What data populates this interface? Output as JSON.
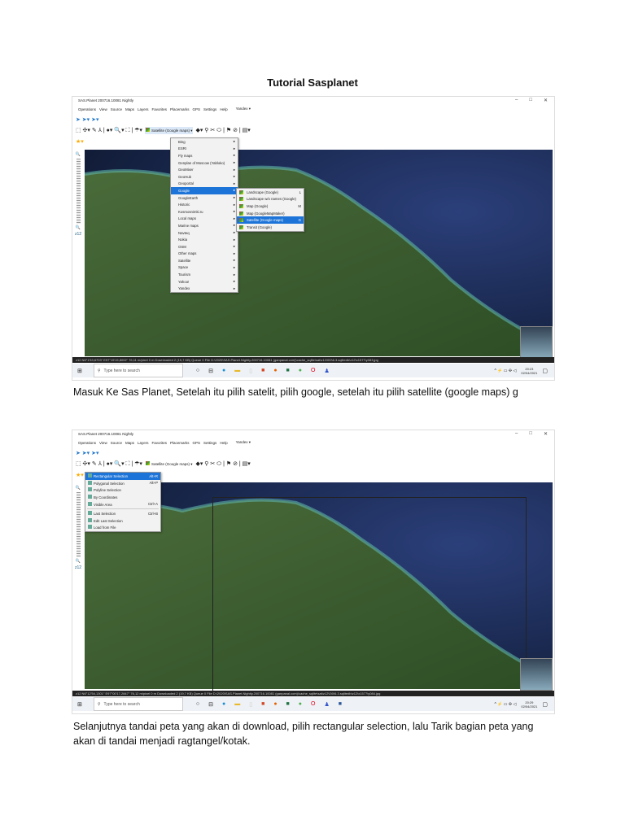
{
  "document": {
    "title": "Tutorial Sasplanet",
    "caption1": "Masuk Ke Sas Planet, Setelah itu pilih satelit, pilih google, setelah itu pilih satellite (google maps) g",
    "caption2_line1": "Selanjutnya tandai peta yang akan di download, pilih rectangular selection, lalu Tarik bagian peta yang",
    "caption2_line2": "akan di tandai menjadi ragtangel/kotak."
  },
  "app": {
    "window_title": "SAS.Planet 200716.10081 Nightly",
    "menu": [
      "Operations",
      "View",
      "Source",
      "Maps",
      "Layers",
      "Favorites",
      "Placemarks",
      "GPS",
      "Settings",
      "Help"
    ],
    "search_provider": "Yandex ▾",
    "map_source": "Satellite (Google maps) ▾",
    "zoom_level": "z12",
    "taskbar_search": "Type here to search"
  },
  "shot1": {
    "maps_menu": [
      "Bing",
      "ESRI",
      "Fly maps",
      "Genplan of Moscow (Yablоko)",
      "GeoMixer",
      "GeoHub",
      "Geoportal",
      "Google",
      "GoogleEarth",
      "Historic",
      "Kosmosnimki.ru",
      "Local maps",
      "Marine maps",
      "Navteq",
      "Nokia",
      "OSM",
      "Other maps",
      "Satellite",
      "Space",
      "Tourism",
      "Yahoo!",
      "Yandex"
    ],
    "google_submenu": [
      {
        "label": "Landscape (Google)",
        "key": "L"
      },
      {
        "label": "Landscape w/o names (Google)",
        "key": ""
      },
      {
        "label": "Map (Google)",
        "key": "M"
      },
      {
        "label": "Map (GoogleMapMaker)",
        "key": ""
      },
      {
        "label": "Satellite (Google maps)",
        "key": "G"
      },
      {
        "label": "Transit (Google)",
        "key": ""
      }
    ],
    "status": "z12   N6°1'53,6703\" E97°15'15,8002\"    76,11 m/pixel    0 m    Downloaded 2 (19,7 KB)    Queue 0    File D:\\2020\\SAS.Planet.Nightly.200716.10081 (ganpanal.com)\\cache_sqlite\\sat\\z12\\0\\0\\6.3.sqlitedb\\z12\\x1577\\y083.jpg",
    "time": "20:23",
    "date": "02/04/2021"
  },
  "shot2": {
    "selection_menu": [
      {
        "label": "Rectangular Selection",
        "key": "Alt+R"
      },
      {
        "label": "Polygonal Selection",
        "key": "Alt+P"
      },
      {
        "label": "Polyline Selection",
        "key": ""
      },
      {
        "label": "By Coordinates",
        "key": ""
      },
      {
        "label": "Visible Area",
        "key": "Ctrl+A"
      },
      {
        "label": "Last Selection",
        "key": "Ctrl+B"
      },
      {
        "label": "Edit Last Selection",
        "key": ""
      },
      {
        "label": "Load from File",
        "key": ""
      }
    ],
    "status": "z12   N6°12'54,1301\" E97°00'17,2847\"    76,12 m/pixel    0 m    Downloaded 2 (19,7 KB)    Queue 0    File D:\\2020\\SAS.Planet.Nightly.200716.10081 (ganpanal.com)\\cache_sqlite\\sat\\z12\\0\\0\\6.3.sqlitedb\\z12\\x1577\\y084.jpg",
    "time": "20:29",
    "date": "02/04/2021"
  }
}
